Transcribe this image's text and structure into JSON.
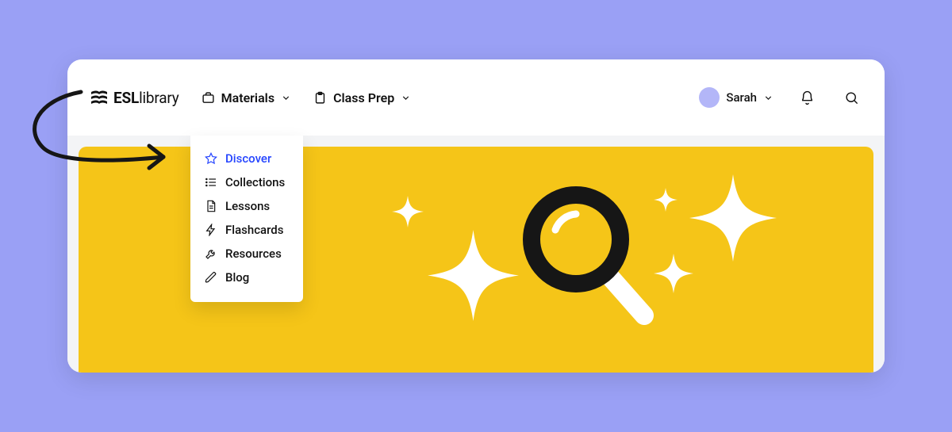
{
  "brand": {
    "name_bold": "ESL",
    "name_light": "library"
  },
  "nav": {
    "materials": {
      "label": "Materials"
    },
    "classprep": {
      "label": "Class Prep"
    }
  },
  "user": {
    "name": "Sarah"
  },
  "dropdown": {
    "items": [
      {
        "label": "Discover"
      },
      {
        "label": "Collections"
      },
      {
        "label": "Lessons"
      },
      {
        "label": "Flashcards"
      },
      {
        "label": "Resources"
      },
      {
        "label": "Blog"
      }
    ]
  },
  "colors": {
    "page_bg": "#9aa0f5",
    "hero_bg": "#f5c518",
    "accent": "#2444ff",
    "avatar": "#b3b6f8"
  }
}
